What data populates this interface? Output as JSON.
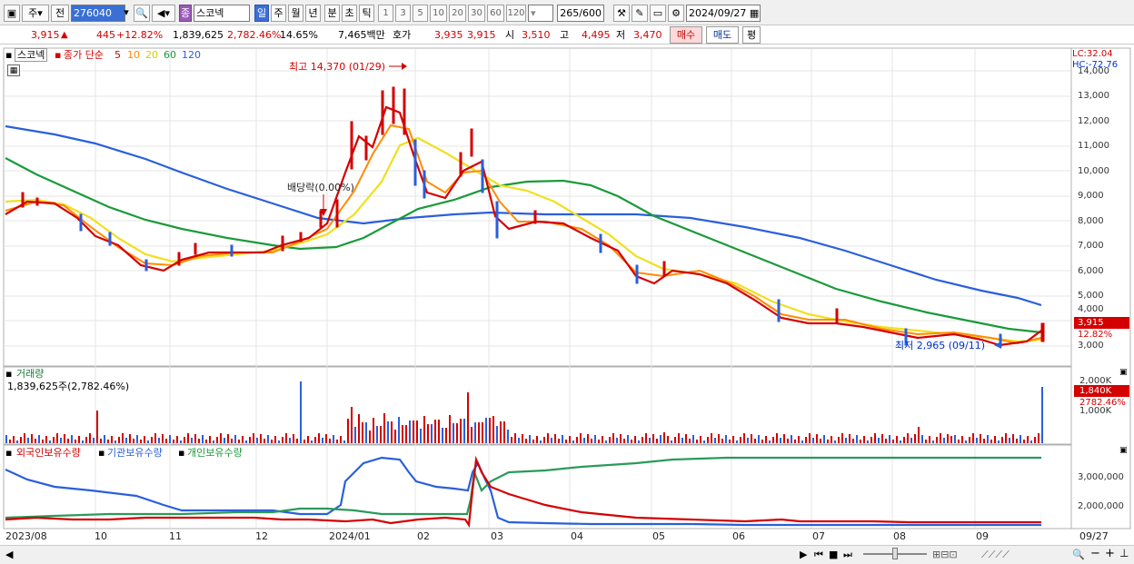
{
  "toolbar": {
    "period_label": "주",
    "prev_label": "전",
    "code_value": "276040",
    "stock_name": "스코넥",
    "stock_badge": "종",
    "period_buttons": [
      "일",
      "주",
      "월",
      "년",
      "분",
      "초",
      "틱"
    ],
    "tick_numbers": [
      "1",
      "3",
      "5",
      "10",
      "20",
      "30",
      "60",
      "120"
    ],
    "count_value": "265",
    "count_total": "/600",
    "date_value": "2024/09/27"
  },
  "info": {
    "price": "3,915",
    "change_arrow": "▲",
    "change": "445",
    "change_pct": "+12.82%",
    "volume": "1,839,625",
    "volume_pct": "2,782.46%",
    "turnover_pct": "14.65%",
    "amount": "7,465백만",
    "bid_label": "호가",
    "bid1": "3,935",
    "bid2": "3,915",
    "open_label": "시",
    "open": "3,510",
    "high_label": "고",
    "high": "4,495",
    "low_label": "저",
    "low": "3,470",
    "buy_label": "매수",
    "sell_label": "매도",
    "avg_label": "평"
  },
  "price_pane": {
    "title": "스코넥",
    "legend_prefix": "종가 단순",
    "ma_periods": [
      "5",
      "10",
      "20",
      "60",
      "120"
    ],
    "ma_colors": [
      "#d40000",
      "#ff8c00",
      "#e8d000",
      "#1a9a3a",
      "#2a5fdc"
    ],
    "lc_label": "LC:32.04",
    "hc_label": "HC:-72.76",
    "max_annotation": "최고 14,370 (01/29)",
    "min_annotation": "최저 2,965 (09/11)",
    "dividend_annotation": "배당락(0.00%)",
    "current_price_tag": "3,915",
    "current_pct_tag": "12.82%",
    "y_ticks": [
      "14,000",
      "13,000",
      "12,000",
      "11,000",
      "10,000",
      "9,000",
      "8,000",
      "7,000",
      "6,000",
      "5,000",
      "4,000",
      "3,000"
    ]
  },
  "volume_pane": {
    "title": "거래량",
    "value_label": "1,839,625주(2,782.46%)",
    "y_ticks": [
      "2,000K",
      "1,000K"
    ],
    "current_tag": "1,840K",
    "current_pct_tag": "2782.46%"
  },
  "holdings_pane": {
    "legend": [
      "외국인보유수량",
      "기관보유수량",
      "개인보유수량"
    ],
    "legend_colors": [
      "#d40000",
      "#2a5fdc",
      "#1a9a3a"
    ],
    "y_ticks": [
      "3,000,000",
      "2,000,000"
    ]
  },
  "x_axis": {
    "labels": [
      "2023/08",
      "10",
      "11",
      "12",
      "2024/01",
      "02",
      "03",
      "04",
      "05",
      "06",
      "07",
      "08",
      "09"
    ],
    "end_label": "09/27"
  },
  "chart_data": {
    "type": "candlestick",
    "title": "스코넥",
    "price_series_close_approx": [
      {
        "date": "2023-08-01",
        "close": 8300
      },
      {
        "date": "2023-08-20",
        "close": 8800
      },
      {
        "date": "2023-09-10",
        "close": 8400
      },
      {
        "date": "2023-10-01",
        "close": 7300
      },
      {
        "date": "2023-10-25",
        "close": 6400
      },
      {
        "date": "2023-11-05",
        "close": 6000
      },
      {
        "date": "2023-11-20",
        "close": 6800
      },
      {
        "date": "2023-12-10",
        "close": 6600
      },
      {
        "date": "2023-12-28",
        "close": 7900
      },
      {
        "date": "2024-01-10",
        "close": 11500
      },
      {
        "date": "2024-01-29",
        "close": 13000
      },
      {
        "date": "2024-02-10",
        "close": 9000
      },
      {
        "date": "2024-02-28",
        "close": 10300
      },
      {
        "date": "2024-03-08",
        "close": 7700
      },
      {
        "date": "2024-04-05",
        "close": 7900
      },
      {
        "date": "2024-04-25",
        "close": 6800
      },
      {
        "date": "2024-05-10",
        "close": 5600
      },
      {
        "date": "2024-05-25",
        "close": 6000
      },
      {
        "date": "2024-06-15",
        "close": 5200
      },
      {
        "date": "2024-07-05",
        "close": 3900
      },
      {
        "date": "2024-08-01",
        "close": 3600
      },
      {
        "date": "2024-09-11",
        "close": 3050
      },
      {
        "date": "2024-09-27",
        "close": 3915
      }
    ],
    "ylim": [
      3000,
      14000
    ],
    "grid": true
  }
}
